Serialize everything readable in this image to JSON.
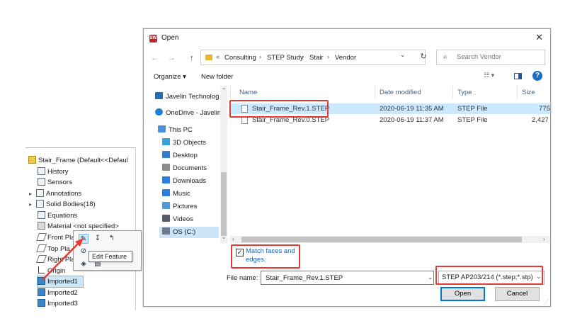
{
  "tree": {
    "rows": [
      {
        "label": "Stair_Frame  (Default<<Defaul",
        "icon": "part-icon",
        "expander": ""
      },
      {
        "label": "History",
        "icon": "history-icon",
        "expander": ""
      },
      {
        "label": "Sensors",
        "icon": "sensors-icon",
        "expander": ""
      },
      {
        "label": "Annotations",
        "icon": "annotations-icon",
        "expander": "▸"
      },
      {
        "label": "Solid Bodies(18)",
        "icon": "solid-bodies-icon",
        "expander": "▸"
      },
      {
        "label": "Equations",
        "icon": "equations-icon",
        "expander": ""
      },
      {
        "label": "Material <not specified>",
        "icon": "material-icon",
        "expander": ""
      },
      {
        "label": "Front Pla",
        "icon": "plane-icon",
        "expander": ""
      },
      {
        "label": "Top Pla",
        "icon": "plane-icon",
        "expander": ""
      },
      {
        "label": "Right Pla",
        "icon": "plane-icon",
        "expander": ""
      },
      {
        "label": "Origin",
        "icon": "origin-icon",
        "expander": ""
      },
      {
        "label": "Imported1",
        "icon": "imported-body-icon",
        "expander": ""
      },
      {
        "label": "Imported2",
        "icon": "imported-body-icon",
        "expander": ""
      },
      {
        "label": "Imported3",
        "icon": "imported-body-icon",
        "expander": ""
      }
    ],
    "tooltip": "Edit Feature"
  },
  "dialog": {
    "title": "Open",
    "close": "✕",
    "nav": {
      "back": "←",
      "forward": "→",
      "up": "↑"
    },
    "breadcrumb": [
      "Consulting",
      "STEP Study",
      "Stair",
      "Vendor"
    ],
    "breadcrumb_overflow": "«",
    "breadcrumb_sep": "›",
    "refresh": "↻",
    "search_placeholder": "Search Vendor",
    "search_icon": "⌕",
    "organize": "Organize ▾",
    "new_folder": "New folder",
    "view_icon": "☷ ▾",
    "help": "?",
    "nav_items": [
      {
        "label": "Javelin Technolog",
        "icon": "cloud-building-icon",
        "color": "#2b6cb0"
      },
      {
        "label": "OneDrive - Javelin",
        "icon": "onedrive-icon",
        "color": "#1e7fd9"
      },
      {
        "label": "This PC",
        "icon": "this-pc-icon",
        "color": "#4a90d9"
      },
      {
        "label": "3D Objects",
        "icon": "3d-objects-icon",
        "color": "#36a3d9"
      },
      {
        "label": "Desktop",
        "icon": "desktop-icon",
        "color": "#2f7fd1"
      },
      {
        "label": "Documents",
        "icon": "documents-icon",
        "color": "#8c8c8c"
      },
      {
        "label": "Downloads",
        "icon": "downloads-icon",
        "color": "#2a7de1"
      },
      {
        "label": "Music",
        "icon": "music-icon",
        "color": "#2a7de1"
      },
      {
        "label": "Pictures",
        "icon": "pictures-icon",
        "color": "#4f9bd6"
      },
      {
        "label": "Videos",
        "icon": "videos-icon",
        "color": "#555a66"
      },
      {
        "label": "OS (C:)",
        "icon": "drive-icon",
        "color": "#6b7b8c"
      }
    ],
    "columns": [
      "Name",
      "Date modified",
      "Type",
      "Size"
    ],
    "files": [
      {
        "name": "Stair_Frame_Rev.1.STEP",
        "date": "2020-06-19 11:35 AM",
        "type": "STEP File",
        "size": "775"
      },
      {
        "name": "Stair_Frame_Rev.0.STEP",
        "date": "2020-06-19 11:37 AM",
        "type": "STEP File",
        "size": "2,427"
      }
    ],
    "options": {
      "match_checked": "✓",
      "match_label": "Match faces and edges."
    },
    "filename_label": "File name:",
    "filename_value": "Stair_Frame_Rev.1.STEP",
    "filetype": "STEP AP203/214 (*.step;*.stp)",
    "dropdown": "⌄",
    "open_label": "Open",
    "cancel_label": "Cancel",
    "scroll_up": "⌃",
    "scroll_down": "⌄",
    "scroll_left": "‹",
    "scroll_right": "›"
  },
  "colors": {
    "annotation_red": "#e53935",
    "selection_blue": "#cce8ff",
    "link_blue": "#1a5fb4"
  }
}
